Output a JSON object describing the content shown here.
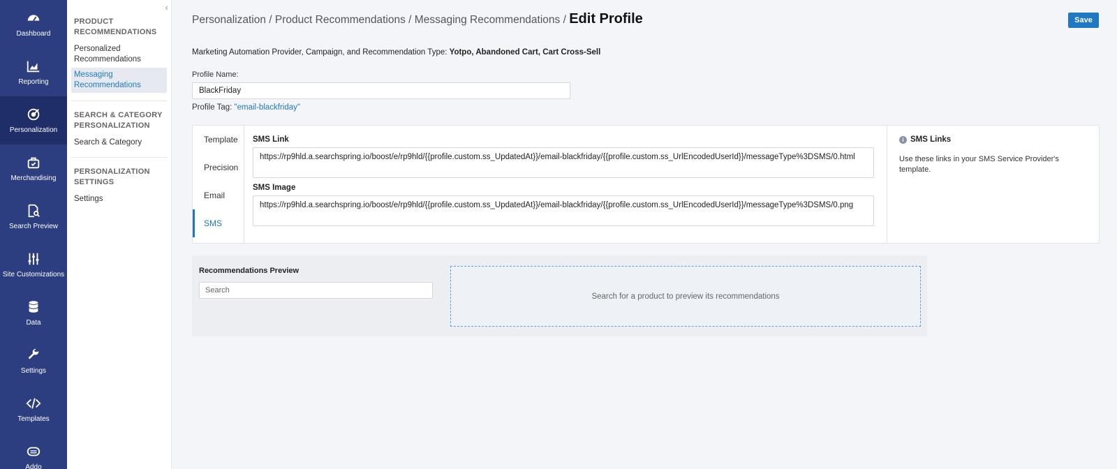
{
  "rail": {
    "items": [
      {
        "label": "Dashboard",
        "icon": "gauge-icon",
        "active": false
      },
      {
        "label": "Reporting",
        "icon": "chart-icon",
        "active": false
      },
      {
        "label": "Personalization",
        "icon": "target-icon",
        "active": true
      },
      {
        "label": "Merchandising",
        "icon": "bag-icon",
        "active": false
      },
      {
        "label": "Search Preview",
        "icon": "doc-search-icon",
        "active": false
      },
      {
        "label": "Site Customizations",
        "icon": "sliders-icon",
        "active": false
      },
      {
        "label": "Data",
        "icon": "database-icon",
        "active": false
      },
      {
        "label": "Settings",
        "icon": "wrench-icon",
        "active": false
      },
      {
        "label": "Templates",
        "icon": "code-icon",
        "active": false
      },
      {
        "label": "Addo",
        "icon": "cloud-icon",
        "active": false
      }
    ]
  },
  "subnav": {
    "collapse_icon": "‹",
    "sections": [
      {
        "heading": "PRODUCT RECOMMENDATIONS",
        "links": [
          "Personalized Recommendations",
          "Messaging Recommendations"
        ]
      },
      {
        "heading": "SEARCH & CATEGORY PERSONALIZATION",
        "links": [
          "Search & Category"
        ]
      },
      {
        "heading": "PERSONALIZATION SETTINGS",
        "links": [
          "Settings"
        ]
      }
    ]
  },
  "breadcrumb": {
    "items": [
      "Personalization",
      "Product Recommendations",
      "Messaging Recommendations"
    ],
    "separator": " / ",
    "current": "Edit Profile"
  },
  "toolbar": {
    "save_label": "Save"
  },
  "marketing": {
    "label": "Marketing Automation Provider, Campaign, and Recommendation Type:",
    "provider": "Yotpo",
    "campaign": "Abandoned Cart",
    "type": "Cart Cross-Sell"
  },
  "profile": {
    "name_label": "Profile Name:",
    "name_value": "BlackFriday",
    "tag_label": "Profile Tag:",
    "tag_value": "\"email-blackfriday\""
  },
  "tabs": [
    "Template",
    "Precision",
    "Email",
    "SMS"
  ],
  "active_tab": "SMS",
  "sms": {
    "link_label": "SMS Link",
    "link_value": "https://rp9hld.a.searchspring.io/boost/e/rp9hld/{{profile.custom.ss_UpdatedAt}}/email-blackfriday/{{profile.custom.ss_UrlEncodedUserId}}/messageType%3DSMS/0.html",
    "image_label": "SMS Image",
    "image_value": "https://rp9hld.a.searchspring.io/boost/e/rp9hld/{{profile.custom.ss_UpdatedAt}}/email-blackfriday/{{profile.custom.ss_UrlEncodedUserId}}/messageType%3DSMS/0.png"
  },
  "help": {
    "title": "SMS Links",
    "text": "Use these links in your SMS Service Provider's template."
  },
  "preview": {
    "title": "Recommendations Preview",
    "search_placeholder": "Search",
    "empty_text": "Search for a product to preview its recommendations"
  },
  "colors": {
    "rail_bg": "#2c3e80",
    "accent": "#1f78c1"
  }
}
